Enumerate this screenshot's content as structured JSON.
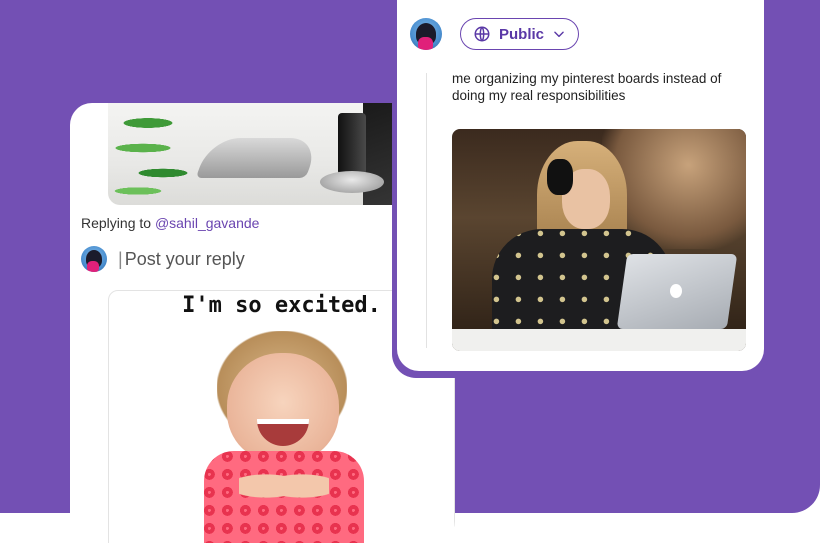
{
  "left_card": {
    "replying_prefix": "Replying to ",
    "replying_handle": "@sahil_gavande",
    "compose_caret": "|",
    "compose_placeholder": "Post your reply",
    "meme_caption": "I'm so excited."
  },
  "right_card": {
    "audience_label": "Public",
    "post_text": "me organizing my pinterest boards instead of doing my real responsibilities"
  },
  "colors": {
    "brand_purple": "#7350b4",
    "mention": "#6a45b0"
  },
  "icons": {
    "audience_icon": "globe-icon",
    "audience_dropdown": "chevron-down-icon"
  }
}
